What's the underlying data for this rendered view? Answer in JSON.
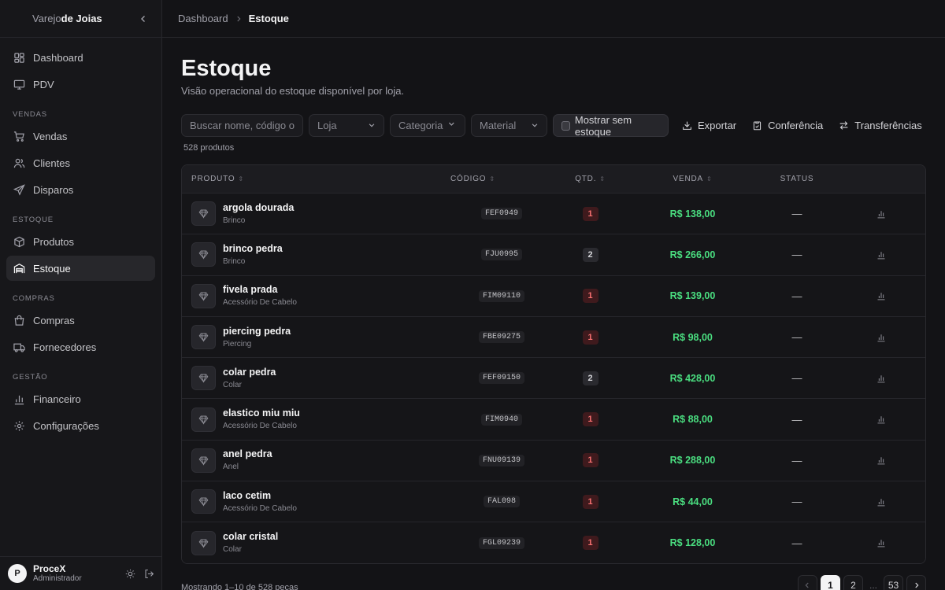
{
  "brand": {
    "prefix": "Varejo",
    "name": "de Joias"
  },
  "nav": {
    "top": [
      {
        "label": "Dashboard",
        "icon": "dashboard-icon"
      },
      {
        "label": "PDV",
        "icon": "monitor-icon"
      }
    ],
    "sections": [
      {
        "title": "Vendas",
        "items": [
          {
            "label": "Vendas"
          },
          {
            "label": "Clientes"
          },
          {
            "label": "Disparos"
          }
        ]
      },
      {
        "title": "Estoque",
        "items": [
          {
            "label": "Produtos"
          },
          {
            "label": "Estoque"
          }
        ]
      },
      {
        "title": "Compras",
        "items": [
          {
            "label": "Compras"
          },
          {
            "label": "Fornecedores"
          }
        ]
      },
      {
        "title": "Gestão",
        "items": [
          {
            "label": "Financeiro"
          },
          {
            "label": "Configurações"
          }
        ]
      }
    ]
  },
  "user": {
    "initial": "P",
    "name": "ProceX",
    "role": "Administrador"
  },
  "breadcrumb": {
    "parent": "Dashboard",
    "current": "Estoque"
  },
  "page": {
    "title": "Estoque",
    "subtitle": "Visão operacional do estoque disponível por loja."
  },
  "filters": {
    "search_placeholder": "Buscar nome, código ou",
    "store": "Loja",
    "category": "Categoria",
    "material": "Material",
    "show_out_of_stock": "Mostrar sem estoque"
  },
  "actions": {
    "export": "Exportar",
    "check": "Conferência",
    "transfers": "Transferências"
  },
  "count_text": "528 produtos",
  "table": {
    "headers": {
      "product": "Produto",
      "code": "Código",
      "qty": "Qtd.",
      "sale": "Venda",
      "status": "Status"
    },
    "rows": [
      {
        "name": "argola dourada",
        "category": "Brinco",
        "code": "FEF0949",
        "qty": "1",
        "low": true,
        "price": "R$ 138,00",
        "status": "—"
      },
      {
        "name": "brinco pedra",
        "category": "Brinco",
        "code": "FJU0995",
        "qty": "2",
        "low": false,
        "price": "R$ 266,00",
        "status": "—"
      },
      {
        "name": "fivela prada",
        "category": "Acessório De Cabelo",
        "code": "FIM09110",
        "qty": "1",
        "low": true,
        "price": "R$ 139,00",
        "status": "—"
      },
      {
        "name": "piercing pedra",
        "category": "Piercing",
        "code": "FBE09275",
        "qty": "1",
        "low": true,
        "price": "R$ 98,00",
        "status": "—"
      },
      {
        "name": "colar pedra",
        "category": "Colar",
        "code": "FEF09150",
        "qty": "2",
        "low": false,
        "price": "R$ 428,00",
        "status": "—"
      },
      {
        "name": "elastico miu miu",
        "category": "Acessório De Cabelo",
        "code": "FIM0940",
        "qty": "1",
        "low": true,
        "price": "R$ 88,00",
        "status": "—"
      },
      {
        "name": "anel pedra",
        "category": "Anel",
        "code": "FNU09139",
        "qty": "1",
        "low": true,
        "price": "R$ 288,00",
        "status": "—"
      },
      {
        "name": "laco cetim",
        "category": "Acessório De Cabelo",
        "code": "FAL098",
        "qty": "1",
        "low": true,
        "price": "R$ 44,00",
        "status": "—"
      },
      {
        "name": "colar cristal",
        "category": "Colar",
        "code": "FGL09239",
        "qty": "1",
        "low": true,
        "price": "R$ 128,00",
        "status": "—"
      }
    ]
  },
  "footer": {
    "showing": "Mostrando 1–10 de 528 peças"
  },
  "pagination": {
    "pages": [
      "1",
      "2"
    ],
    "ellipsis": "...",
    "last": "53",
    "current": "1"
  },
  "colors": {
    "price": "#4ade80",
    "low_stock": "#f87171",
    "background": "#131316"
  }
}
